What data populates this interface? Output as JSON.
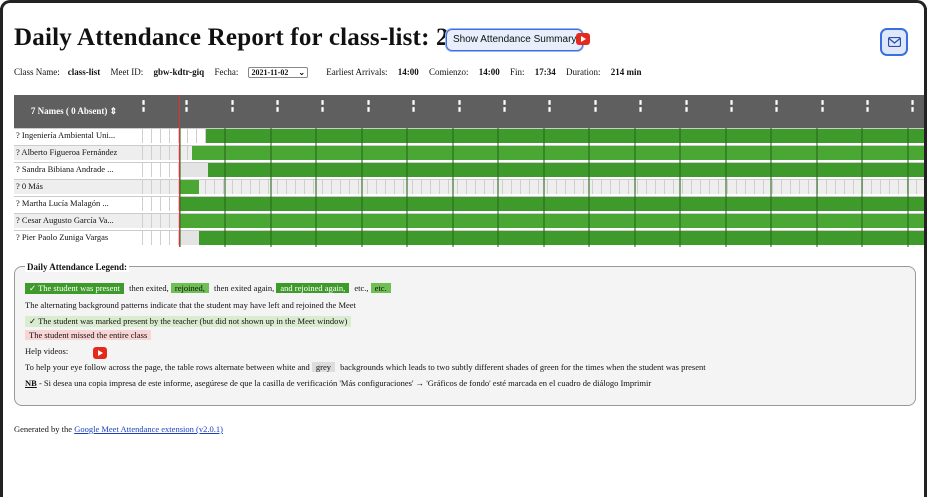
{
  "header": {
    "title": "Daily Attendance Report for class-list: 2021-11-02",
    "summary_button": "Show Attendance Summary"
  },
  "meta": {
    "class_label": "Class Name:",
    "class_value": "class-list",
    "meet_label": "Meet ID:",
    "meet_value": "gbw-kdtr-giq",
    "fecha_label": "Fecha:",
    "fecha_value": "2021-11-02",
    "earliest_label": "Earliest Arrivals:",
    "earliest_value": "14:00",
    "comienzo_label": "Comienzo:",
    "comienzo_value": "14:00",
    "fin_label": "Fin:",
    "fin_value": "17:34",
    "duration_label": "Duration:",
    "duration_value": "214 min"
  },
  "grid": {
    "names_header": "7 Names ( 0 Absent)",
    "rows": [
      {
        "name": "? Ingeniería Ambiental Uni..."
      },
      {
        "name": "? Alberto Figueroa Fernández"
      },
      {
        "name": "? Sandra Bibiana Andrade ..."
      },
      {
        "name": "? 0 Más"
      },
      {
        "name": "? Martha Lucía Malagón ..."
      },
      {
        "name": "? Cesar Augusto García Va..."
      },
      {
        "name": "? Pier Paolo Zuniga Vargas"
      }
    ]
  },
  "legend": {
    "title": "Daily Attendance Legend:",
    "present": "✓ The student was present",
    "then_exited": "then exited,",
    "rejoined": "rejoined,",
    "then_exited_again": "then exited again,",
    "rejoined_again": "and rejoined again,",
    "etc1": "etc.,",
    "etc2": "etc.",
    "alternating": "The alternating background patterns indicate that the student may have left and rejoined the Meet",
    "marked_present": "✓ The student was marked present by the teacher (but did not shown up in the Meet window)",
    "missed": "The student missed the entire class",
    "help_videos": "Help videos:",
    "eye_follow_a": "To help your eye follow across the page, the table rows alternate between white and",
    "grey": "grey",
    "eye_follow_b": "backgrounds which leads to two subtly different shades of green for the times when the student was present",
    "nb": "NB",
    "nb_text": "- Si desea una copia impresa de este informe, asegúrese de que la casilla de verificación 'Más configuraciones' → 'Gráficos de fondo' esté marcada en el cuadro de diálogo Imprimir"
  },
  "footer": {
    "generated_by": "Generated by the",
    "link": "Google Meet Attendance extension (v2.0.1)"
  },
  "colors": {
    "accent": "#3b6fe0",
    "present_dark": "#3f9a2c",
    "present_light": "#4aa734",
    "youtube": "#e42a1d"
  }
}
